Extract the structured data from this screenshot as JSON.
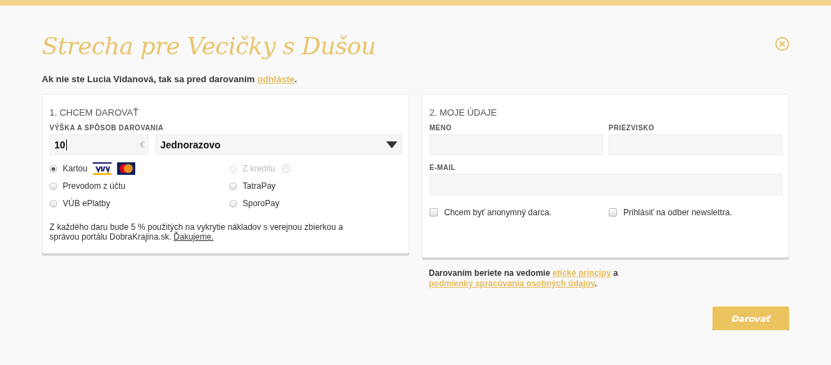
{
  "title": "Strecha pre Vecičky s Dušou",
  "logout_note": [
    {
      "text": "Ak nie ste Lucia Vidanová, tak sa pred darovaním "
    },
    {
      "text": "odhláste",
      "kind": "link"
    },
    {
      "text": "."
    }
  ],
  "donate": {
    "heading": "1. CHCEM DAROVAŤ",
    "label": "VÝŠKA A SPÔSOB DAROVANIA",
    "amount": "10",
    "currency": "€",
    "frequency": "Jednorazovo",
    "methods": [
      {
        "label": "Kartou",
        "selected": true,
        "disabled": false,
        "cards": true
      },
      {
        "label": "Z kreditu",
        "selected": false,
        "disabled": true,
        "help": "?"
      },
      {
        "label": "Prevodom z účtu",
        "selected": false,
        "disabled": false
      },
      {
        "label": "TatraPay",
        "selected": false,
        "disabled": false
      },
      {
        "label": "VÚB ePlatby",
        "selected": false,
        "disabled": false
      },
      {
        "label": "SporoPay",
        "selected": false,
        "disabled": false
      }
    ],
    "note": [
      {
        "text": "Z každého daru bude 5 % použitých na vykrytie nákladov s verejnou zbierkou a správou portálu DobraKrajina.sk. "
      },
      {
        "text": "Ďakujeme.",
        "kind": "underline"
      }
    ]
  },
  "details": {
    "heading": "2. MOJE ÚDAJE",
    "fields": [
      {
        "label": "MENO",
        "wide": false
      },
      {
        "label": "PRIEZVISKO",
        "wide": false
      },
      {
        "label": "E-MAIL",
        "wide": true
      }
    ],
    "checkboxes": [
      {
        "label": "Chcem byť anonymný darca.",
        "checked": false
      },
      {
        "label": "Prihlásiť na odber newslettra.",
        "checked": false
      }
    ]
  },
  "consent": [
    {
      "text": "Darovaním beriete na vedomie "
    },
    {
      "text": "etické princípy",
      "kind": "link"
    },
    {
      "text": " a "
    },
    {
      "text": "podmienky spracúvania osobných údajov",
      "kind": "link"
    },
    {
      "text": "."
    }
  ],
  "submit": "Darovať"
}
